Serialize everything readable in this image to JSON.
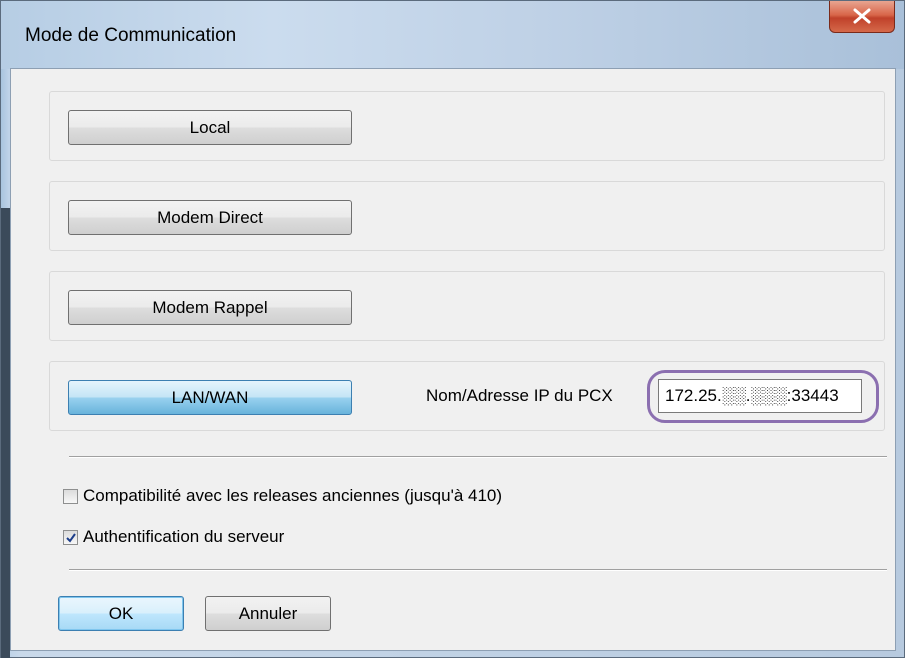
{
  "window": {
    "title": "Mode de Communication",
    "close_icon": "close-icon"
  },
  "modes": {
    "local": "Local",
    "modem_direct": "Modem Direct",
    "modem_rappel": "Modem Rappel",
    "lan_wan": "LAN/WAN"
  },
  "lan": {
    "ip_label": "Nom/Adresse IP du PCX",
    "ip_value": "172.25.░░.░░░:33443"
  },
  "options": {
    "compat_label": "Compatibilité avec les releases anciennes (jusqu'à 410)",
    "compat_checked": false,
    "auth_label": "Authentification du serveur",
    "auth_checked": true
  },
  "footer": {
    "ok_label": "OK",
    "cancel_label": "Annuler"
  },
  "colors": {
    "accent": "#68b3db",
    "highlight_ring": "#8b6fb0",
    "close_red": "#c0412a"
  }
}
